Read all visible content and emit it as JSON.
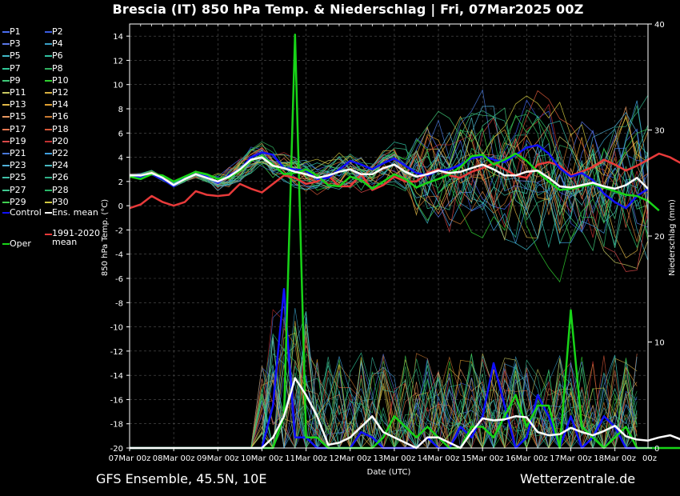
{
  "title": "Brescia  (IT)  850 hPa Temp. & Niederschlag | Fri, 07Mar2025 00Z",
  "footer": {
    "left": "GFS Ensemble, 45.5N, 10E",
    "right": "Wetterzentrale.de"
  },
  "colors": {
    "background": "#000000",
    "grid": "#555555",
    "control": "#1010ff",
    "ens_mean": "#ffffff",
    "climate_mean": "#e83a3a",
    "oper": "#18d418"
  },
  "legend": [
    {
      "label": "P1",
      "color": "#4a6cf0"
    },
    {
      "label": "P2",
      "color": "#3a5ce0"
    },
    {
      "label": "P3",
      "color": "#5a78e8"
    },
    {
      "label": "P4",
      "color": "#3aa0c8"
    },
    {
      "label": "P5",
      "color": "#40b8c8"
    },
    {
      "label": "P6",
      "color": "#30c0a0"
    },
    {
      "label": "P7",
      "color": "#30c898"
    },
    {
      "label": "P8",
      "color": "#30b060"
    },
    {
      "label": "P9",
      "color": "#40c878"
    },
    {
      "label": "P10",
      "color": "#30d030"
    },
    {
      "label": "P11",
      "color": "#c8c860"
    },
    {
      "label": "P12",
      "color": "#d8b040"
    },
    {
      "label": "P13",
      "color": "#e0b848"
    },
    {
      "label": "P14",
      "color": "#e0a030"
    },
    {
      "label": "P15",
      "color": "#e89860"
    },
    {
      "label": "P16",
      "color": "#c87830"
    },
    {
      "label": "P17",
      "color": "#e87850"
    },
    {
      "label": "P18",
      "color": "#d85838"
    },
    {
      "label": "P19",
      "color": "#d84848"
    },
    {
      "label": "P20",
      "color": "#c03030"
    },
    {
      "label": "P21",
      "color": "#4878d8"
    },
    {
      "label": "P22",
      "color": "#40a0e0"
    },
    {
      "label": "P23",
      "color": "#50b0d8"
    },
    {
      "label": "P24",
      "color": "#48b8c0"
    },
    {
      "label": "P25",
      "color": "#40c0a8"
    },
    {
      "label": "P26",
      "color": "#30b088"
    },
    {
      "label": "P27",
      "color": "#40c890"
    },
    {
      "label": "P28",
      "color": "#28b868"
    },
    {
      "label": "P29",
      "color": "#40d050"
    },
    {
      "label": "P30",
      "color": "#d0c840"
    },
    {
      "label": "Control",
      "color": "#1010ff"
    },
    {
      "label": "Ens. mean",
      "color": "#ffffff"
    },
    {
      "label": "1991-2020 mean",
      "color": "#e83a3a"
    },
    {
      "label": "Oper",
      "color": "#18d418"
    }
  ],
  "chart_data": {
    "type": "line",
    "xlabel": "Date (UTC)",
    "ylabel": "850 hPa Temp. (°C)",
    "y2label": "Niederschlag (mm)",
    "x_ticks": [
      "07Mar 00z",
      "08Mar 00z",
      "09Mar 00z",
      "10Mar 00z",
      "11Mar 00z",
      "12Mar 00z",
      "13Mar 00z",
      "14Mar 00z",
      "15Mar 00z",
      "16Mar 00z",
      "17Mar 00z",
      "18Mar 00z"
    ],
    "x_end_label": "00z",
    "xlim_hours": [
      0,
      282
    ],
    "ylim": [
      -20,
      15
    ],
    "y_ticks": [
      -20,
      -18,
      -16,
      -14,
      -12,
      -10,
      -8,
      -6,
      -4,
      -2,
      0,
      2,
      4,
      6,
      8,
      10,
      12,
      14
    ],
    "y2lim": [
      0,
      40
    ],
    "y2_ticks": [
      0,
      10,
      20,
      30,
      40
    ],
    "grid": true,
    "time_step_hours": 6,
    "temperature": {
      "control": [
        2.5,
        2.3,
        2.6,
        2.2,
        1.6,
        2.3,
        2.6,
        2.4,
        1.9,
        2.5,
        3.0,
        4.0,
        4.4,
        4.2,
        3.1,
        3.0,
        2.9,
        2.2,
        2.3,
        3.0,
        3.7,
        3.4,
        3.0,
        3.5,
        3.9,
        3.3,
        2.7,
        2.5,
        2.9,
        3.0,
        3.4,
        3.9,
        4.1,
        3.8,
        3.6,
        4.2,
        4.8,
        5.0,
        4.3,
        3.1,
        2.4,
        2.7,
        2.1,
        1.0,
        0.3,
        -0.2,
        0.8,
        1.4
      ],
      "ens_mean": [
        2.5,
        2.5,
        2.7,
        2.3,
        1.7,
        2.2,
        2.6,
        2.3,
        2.0,
        2.4,
        3.0,
        3.8,
        4.0,
        3.3,
        3.1,
        2.8,
        2.6,
        2.3,
        2.5,
        2.8,
        3.0,
        2.6,
        2.6,
        3.1,
        3.4,
        2.8,
        2.4,
        2.6,
        2.9,
        2.7,
        2.8,
        3.1,
        3.4,
        3.0,
        2.5,
        2.5,
        2.8,
        2.9,
        2.3,
        1.6,
        1.5,
        1.7,
        1.9,
        1.6,
        1.4,
        1.7,
        2.3,
        1.4
      ],
      "climate_mean": [
        -0.2,
        0.1,
        0.8,
        0.3,
        0.0,
        0.3,
        1.2,
        0.9,
        0.8,
        0.9,
        1.8,
        1.4,
        1.1,
        1.8,
        2.5,
        2.3,
        1.8,
        2.0,
        2.5,
        1.6,
        1.6,
        2.6,
        1.3,
        1.7,
        2.4,
        2.0,
        2.0,
        2.7,
        3.0,
        2.5,
        2.3,
        2.8,
        3.1,
        3.5,
        3.0,
        2.5,
        2.3,
        3.4,
        3.6,
        3.3,
        2.5,
        2.8,
        3.2,
        3.8,
        3.4,
        2.9,
        3.3,
        3.8,
        4.3,
        4.0,
        3.5
      ],
      "oper": [
        2.4,
        2.2,
        2.6,
        2.5,
        2.0,
        2.4,
        2.8,
        2.6,
        2.2,
        2.3,
        2.9,
        3.7,
        4.1,
        3.4,
        2.6,
        2.7,
        3.0,
        2.5,
        1.7,
        1.6,
        2.4,
        2.1,
        1.4,
        2.0,
        2.6,
        2.2,
        1.5,
        1.9,
        2.2,
        2.6,
        3.2,
        4.1,
        4.2,
        3.4,
        3.8,
        4.3,
        3.7,
        2.8,
        2.0,
        1.3,
        1.4,
        1.6,
        1.8,
        1.5,
        1.2,
        0.9,
        0.8,
        0.4,
        -0.4
      ]
    },
    "precipitation": {
      "control": [
        0,
        0,
        0,
        0,
        0,
        0,
        0,
        0,
        0,
        0,
        0,
        0,
        0,
        4,
        15,
        1,
        1,
        0,
        0,
        0,
        0,
        1.5,
        1,
        0,
        0,
        0,
        0,
        1,
        0,
        0,
        2,
        1,
        3,
        8,
        4,
        0,
        1,
        5,
        3,
        0,
        3,
        0,
        1,
        3,
        2,
        0,
        0,
        0,
        0
      ],
      "ens_mean": [
        0,
        0,
        0,
        0,
        0,
        0,
        0,
        0,
        0,
        0,
        0,
        0,
        0,
        1,
        3,
        6.6,
        5,
        3,
        0.3,
        0.5,
        1,
        2,
        3,
        1.5,
        1,
        0.5,
        0,
        1,
        1,
        0.5,
        0,
        1.5,
        2.8,
        2.6,
        2.7,
        3,
        2.9,
        1.5,
        1.2,
        1.3,
        1.9,
        1.5,
        1.2,
        1.6,
        2.1,
        1.1,
        0.8,
        0.7,
        1.0,
        1.2,
        0.8,
        0.4
      ],
      "oper": [
        0,
        0,
        0,
        0,
        0,
        0,
        0,
        0,
        0,
        0,
        0,
        0,
        0,
        0,
        3,
        39,
        1,
        1,
        0,
        0,
        0,
        0,
        0,
        1,
        3,
        2,
        1,
        2,
        1,
        0,
        0,
        2,
        2,
        1,
        3,
        5,
        2,
        4,
        4,
        0,
        13,
        2,
        1,
        0,
        1,
        2,
        0,
        0,
        0,
        0,
        0,
        0
      ]
    }
  }
}
